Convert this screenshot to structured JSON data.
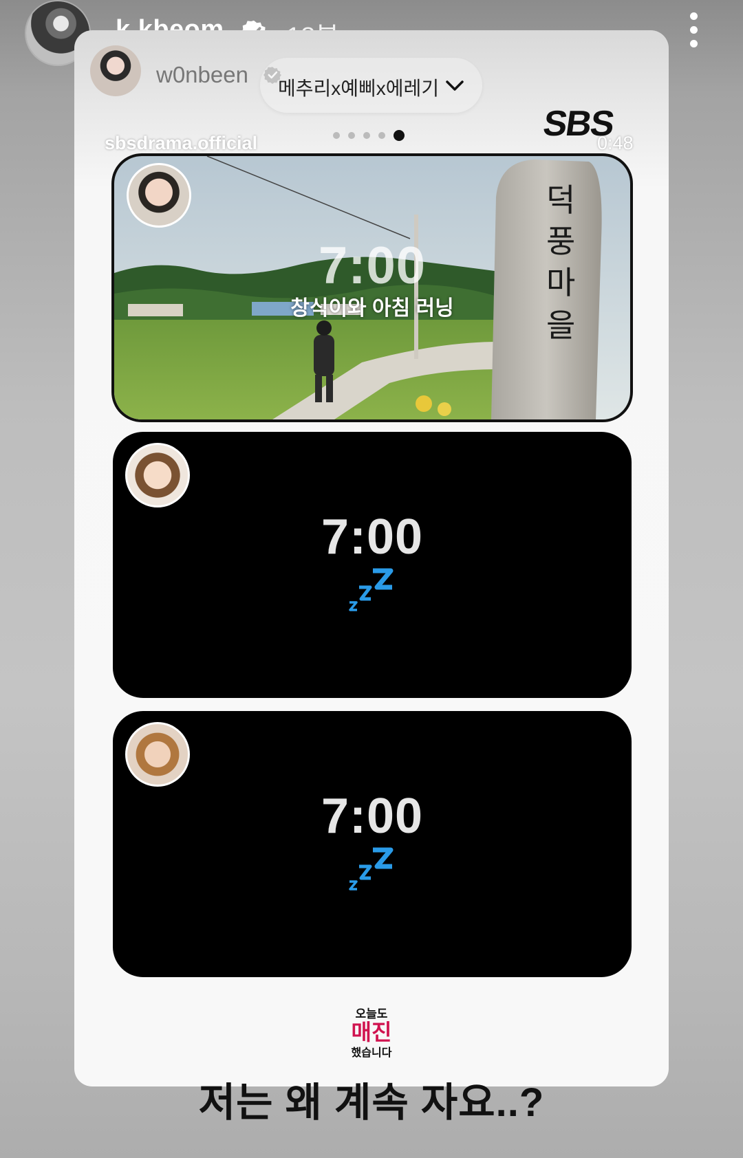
{
  "header": {
    "username": "k.kbeom",
    "time_ago": "18분",
    "menu_icon": "more-vertical-icon"
  },
  "repost": {
    "username": "w0nbeen",
    "music_label": "메추리x예삐x에레기"
  },
  "video": {
    "account": "sbsdrama.official",
    "duration": "0:48",
    "network_logo": "SBS",
    "progress_dots": 5,
    "active_dot": 4
  },
  "panels": [
    {
      "time": "7:00",
      "caption": "창식이와 아침 러닝",
      "sign_text": [
        "덕",
        "풍",
        "마",
        "을"
      ]
    },
    {
      "time": "7:00",
      "sleep_icon": "zzz"
    },
    {
      "time": "7:00",
      "sleep_icon": "zzz"
    }
  ],
  "show_logo": {
    "line1": "오늘도",
    "line2": "매진",
    "line3": "했습니다"
  },
  "bottom_caption": "저는 왜 계속 자요..?",
  "colors": {
    "accent_pink": "#d0134f",
    "zzz_blue": "#2a9be8"
  }
}
